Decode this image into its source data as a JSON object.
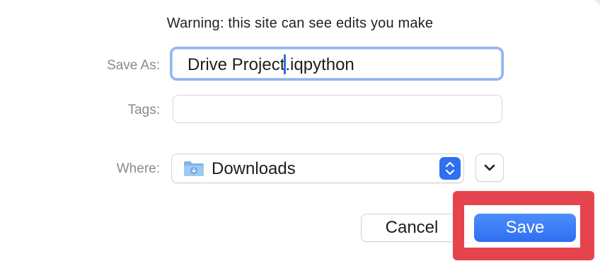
{
  "dialog": {
    "warning": "Warning: this site can see edits you make",
    "save_as": {
      "label": "Save As:",
      "value_before_caret": "Drive Project",
      "value_after_caret": ".iqpython"
    },
    "tags": {
      "label": "Tags:",
      "value": ""
    },
    "where": {
      "label": "Where:",
      "value": "Downloads"
    },
    "buttons": {
      "cancel": "Cancel",
      "save": "Save"
    }
  },
  "colors": {
    "accent": "#2f6ff0",
    "focus_ring": "#93b4f2",
    "highlight_box": "#e5434d",
    "label_gray": "#8a8a8a"
  },
  "icons": {
    "folder": "downloads-folder-icon",
    "updown": "up-down-chevron-icon",
    "expand": "chevron-down-icon"
  }
}
